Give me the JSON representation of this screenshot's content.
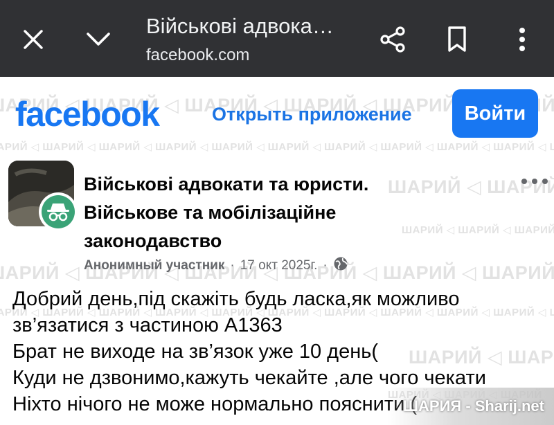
{
  "browser": {
    "title": "Військові адвока…",
    "url": "facebook.com",
    "icons": [
      "close-icon",
      "chevron-down-icon",
      "share-icon",
      "bookmark-icon",
      "more-vert-icon"
    ],
    "bar_color": "#303134"
  },
  "watermark": {
    "text": "ШАРИЙ",
    "corner_text": "ШАРИЯ - Sharij.net"
  },
  "facebook": {
    "logo": "facebook",
    "open_app": "Открыть приложение",
    "login": "Войти",
    "brand_color": "#1877f2"
  },
  "post": {
    "group_name": "Військові адвокати та юристи. Військове та мобілізаційне законодавство",
    "author": "Анонимный участник",
    "separator": "·",
    "date": "17 окт 2025г.",
    "privacy_icon": "globe-icon",
    "more_icon": "more-horiz-icon",
    "body_lines": [
      "Добрий день,під скажіть будь ласка,як можливо",
      "зв’язатися з частиною А1363",
      "Брат не виходе на зв’язок уже 10 день(",
      "Куди не дзвонимо,кажуть чекайте ,але чого чекати",
      "Ніхто нічого не може нормально пояснити ("
    ]
  }
}
